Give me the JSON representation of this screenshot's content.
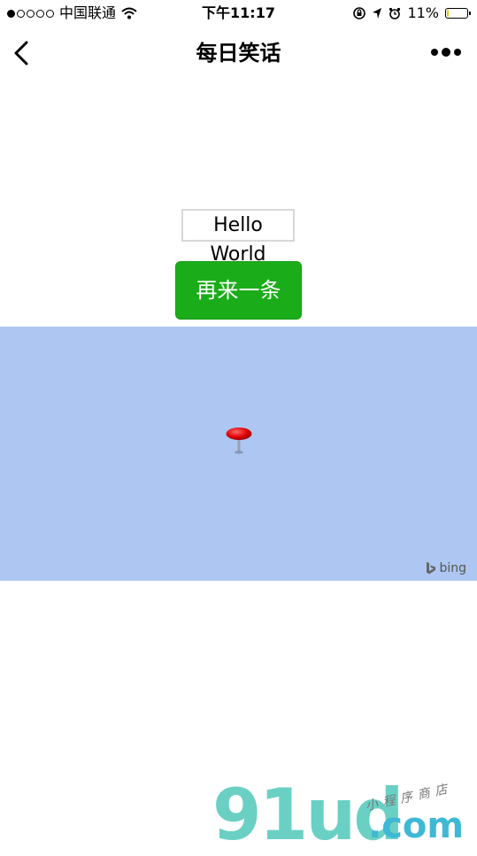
{
  "status_bar": {
    "carrier": "中国联通",
    "time": "下午11:17",
    "battery_percent": "11%",
    "battery_level": 0.11,
    "icons": [
      "signal-icon",
      "wifi-icon",
      "orientation-lock-icon",
      "location-icon",
      "alarm-icon",
      "battery-icon"
    ]
  },
  "nav": {
    "title": "每日笑话",
    "back_icon": "chevron-left-icon",
    "more_icon": "more-dots-icon"
  },
  "content": {
    "joke_text": "Hello World",
    "next_button": "再来一条"
  },
  "map": {
    "background_color": "#adc6f2",
    "marker_icon": "map-pin-icon",
    "provider": "bing"
  },
  "watermark": {
    "main": "91ud",
    "sub": ".com",
    "tagline": "小程序商店"
  },
  "colors": {
    "accent_green": "#1aad19",
    "map_blue": "#adc6f2"
  }
}
